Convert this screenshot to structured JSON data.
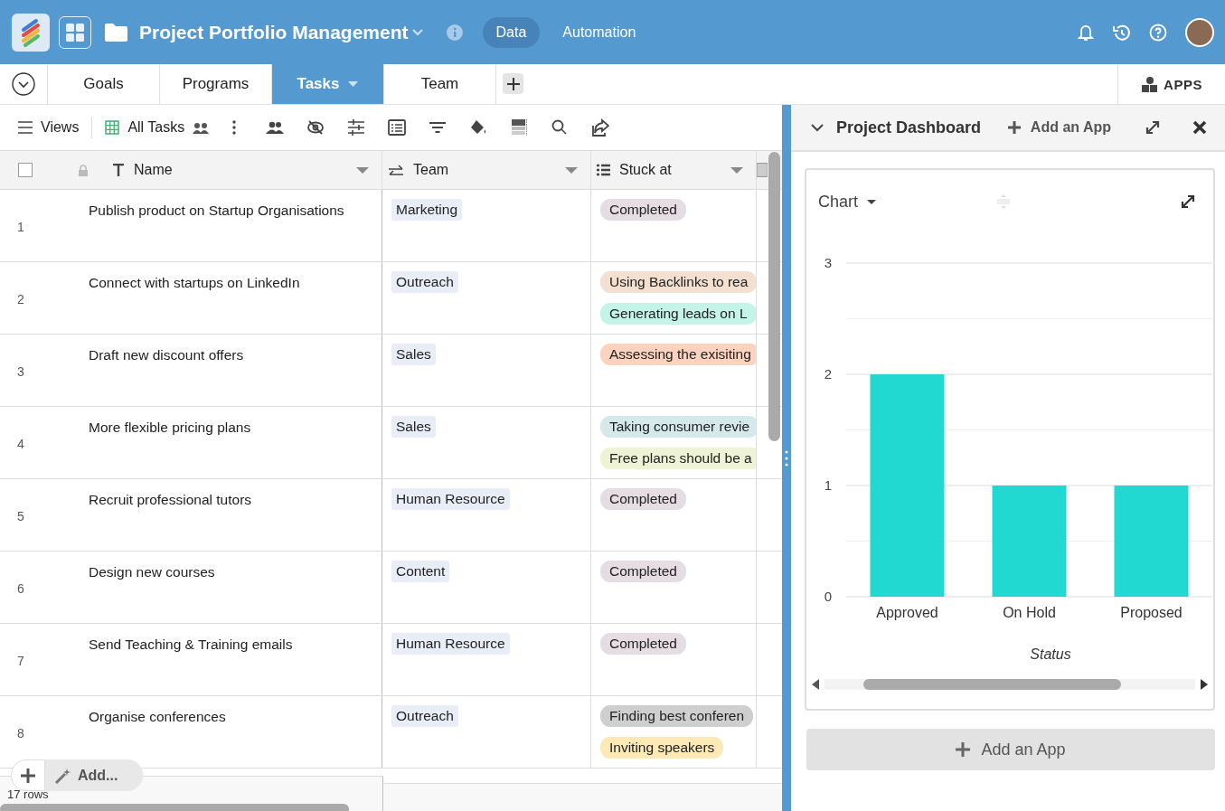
{
  "header": {
    "title": "Project Portfolio Management",
    "nav": [
      {
        "label": "Data",
        "selected": true
      },
      {
        "label": "Automation",
        "selected": false
      }
    ]
  },
  "tabs": [
    {
      "label": "Goals",
      "selected": false
    },
    {
      "label": "Programs",
      "selected": false
    },
    {
      "label": "Tasks",
      "selected": true
    },
    {
      "label": "Team",
      "selected": false
    }
  ],
  "apps_button": "APPS",
  "toolbar": {
    "views": "Views",
    "view_name": "All Tasks"
  },
  "table": {
    "columns": [
      "Name",
      "Team",
      "Stuck at"
    ],
    "rows": [
      {
        "number": "1",
        "name": "Publish product on Startup Organisations",
        "team": "Marketing",
        "stuck_at": [
          {
            "label": "Completed",
            "color": "#e6dde2"
          }
        ]
      },
      {
        "number": "2",
        "name": "Connect with startups on LinkedIn",
        "team": "Outreach",
        "stuck_at": [
          {
            "label": "Using Backlinks to rea",
            "color": "#f3e0d0"
          },
          {
            "label": "Generating leads on L",
            "color": "#c4f4e8"
          }
        ]
      },
      {
        "number": "3",
        "name": "Draft new discount offers",
        "team": "Sales",
        "stuck_at": [
          {
            "label": "Assessing the exisiting",
            "color": "#fdd2bf"
          }
        ]
      },
      {
        "number": "4",
        "name": "More flexible pricing plans",
        "team": "Sales",
        "stuck_at": [
          {
            "label": "Taking consumer revie",
            "color": "#d5e9ec"
          },
          {
            "label": "Free plans should be a",
            "color": "#eff3d5"
          }
        ]
      },
      {
        "number": "5",
        "name": "Recruit professional tutors",
        "team": "Human Resource",
        "stuck_at": [
          {
            "label": "Completed",
            "color": "#e6dde2"
          }
        ]
      },
      {
        "number": "6",
        "name": "Design new courses",
        "team": "Content",
        "stuck_at": [
          {
            "label": "Completed",
            "color": "#e6dde2"
          }
        ]
      },
      {
        "number": "7",
        "name": "Send Teaching & Training emails",
        "team": "Human Resource",
        "stuck_at": [
          {
            "label": "Completed",
            "color": "#e6dde2"
          }
        ]
      },
      {
        "number": "8",
        "name": "Organise conferences",
        "team": "Outreach",
        "stuck_at": [
          {
            "label": "Finding best conferen",
            "color": "#cfcfcf"
          },
          {
            "label": "Inviting speakers",
            "color": "#fde9b5"
          }
        ]
      }
    ],
    "add_label": "Add...",
    "row_count": "17 rows"
  },
  "dashboard": {
    "title": "Project Dashboard",
    "add_app": "Add an App",
    "widget": {
      "selector": "Chart",
      "chart_data": {
        "type": "bar",
        "xlabel": "Status",
        "categories": [
          "Approved",
          "On Hold",
          "Proposed"
        ],
        "values": [
          2,
          1,
          1
        ],
        "ylim": [
          0,
          3
        ],
        "yticks": [
          0,
          1,
          2,
          3
        ]
      }
    },
    "add_app_button": "Add an App"
  }
}
